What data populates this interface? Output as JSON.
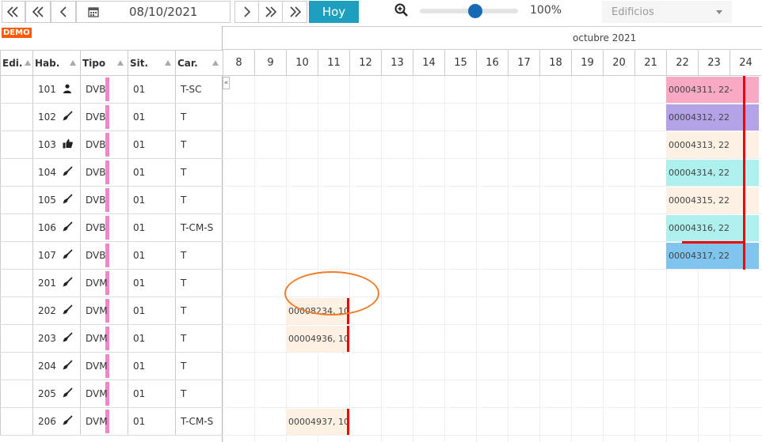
{
  "toolbar": {
    "date": "08/10/2021",
    "today_label": "Hoy",
    "zoom": "100%",
    "zoom_slider_level": 0.5,
    "building_placeholder": "Edificios"
  },
  "demo_badge": "DEMO",
  "columns": {
    "edi": "Edi.",
    "hab": "Hab.",
    "tipo": "Tipo",
    "sit": "Sit.",
    "car": "Car."
  },
  "calendar": {
    "month": "octubre 2021",
    "days": [
      "8",
      "9",
      "10",
      "11",
      "12",
      "13",
      "14",
      "15",
      "16",
      "17",
      "18",
      "19",
      "20",
      "21",
      "22",
      "23",
      "24"
    ],
    "collapse_label": "«"
  },
  "rooms": [
    {
      "hab": "101",
      "icon": "person-icon",
      "tipo": "DVB",
      "sit": "01",
      "car": "T-SC"
    },
    {
      "hab": "102",
      "icon": "broom-icon",
      "tipo": "DVB",
      "sit": "01",
      "car": "T"
    },
    {
      "hab": "103",
      "icon": "thumbs-up-icon",
      "tipo": "DVB",
      "sit": "01",
      "car": "T"
    },
    {
      "hab": "104",
      "icon": "broom-icon",
      "tipo": "DVB",
      "sit": "01",
      "car": "T"
    },
    {
      "hab": "105",
      "icon": "broom-icon",
      "tipo": "DVB",
      "sit": "01",
      "car": "T"
    },
    {
      "hab": "106",
      "icon": "broom-icon",
      "tipo": "DVB",
      "sit": "01",
      "car": "T-CM-S"
    },
    {
      "hab": "107",
      "icon": "broom-icon",
      "tipo": "DVB",
      "sit": "01",
      "car": "T"
    },
    {
      "hab": "201",
      "icon": "broom-icon",
      "tipo": "DVM",
      "sit": "01",
      "car": "T"
    },
    {
      "hab": "202",
      "icon": "broom-icon",
      "tipo": "DVM",
      "sit": "01",
      "car": "T"
    },
    {
      "hab": "203",
      "icon": "broom-icon",
      "tipo": "DVM",
      "sit": "01",
      "car": "T"
    },
    {
      "hab": "204",
      "icon": "broom-icon",
      "tipo": "DVM",
      "sit": "01",
      "car": "T"
    },
    {
      "hab": "205",
      "icon": "broom-icon",
      "tipo": "DVM",
      "sit": "01",
      "car": "T"
    },
    {
      "hab": "206",
      "icon": "broom-icon",
      "tipo": "DVM",
      "sit": "01",
      "car": "T-CM-S"
    }
  ],
  "bookings": [
    {
      "row": 0,
      "label": "00004311, 22-",
      "day_start": "22",
      "color": "#f8a9c3"
    },
    {
      "row": 1,
      "label": "00004312, 22",
      "day_start": "22",
      "color": "#b3a3e6"
    },
    {
      "row": 2,
      "label": "00004313, 22",
      "day_start": "22",
      "color": "#fdf1e4"
    },
    {
      "row": 3,
      "label": "00004314, 22",
      "day_start": "22",
      "color": "#aef0ee"
    },
    {
      "row": 4,
      "label": "00004315, 22",
      "day_start": "22",
      "color": "#fdf1e4"
    },
    {
      "row": 5,
      "label": "00004316, 22",
      "day_start": "22",
      "color": "#aef0ee"
    },
    {
      "row": 6,
      "label": "00004317, 22",
      "day_start": "22",
      "color": "#7ec4ec"
    },
    {
      "row": 8,
      "label": "00008234, 10",
      "day_start": "10",
      "color": "#fdf1e4"
    },
    {
      "row": 9,
      "label": "00004936, 10",
      "day_start": "10",
      "color": "#fdf1e4"
    },
    {
      "row": 12,
      "label": "00004937, 10",
      "day_start": "10",
      "color": "#fdf1e4"
    }
  ]
}
